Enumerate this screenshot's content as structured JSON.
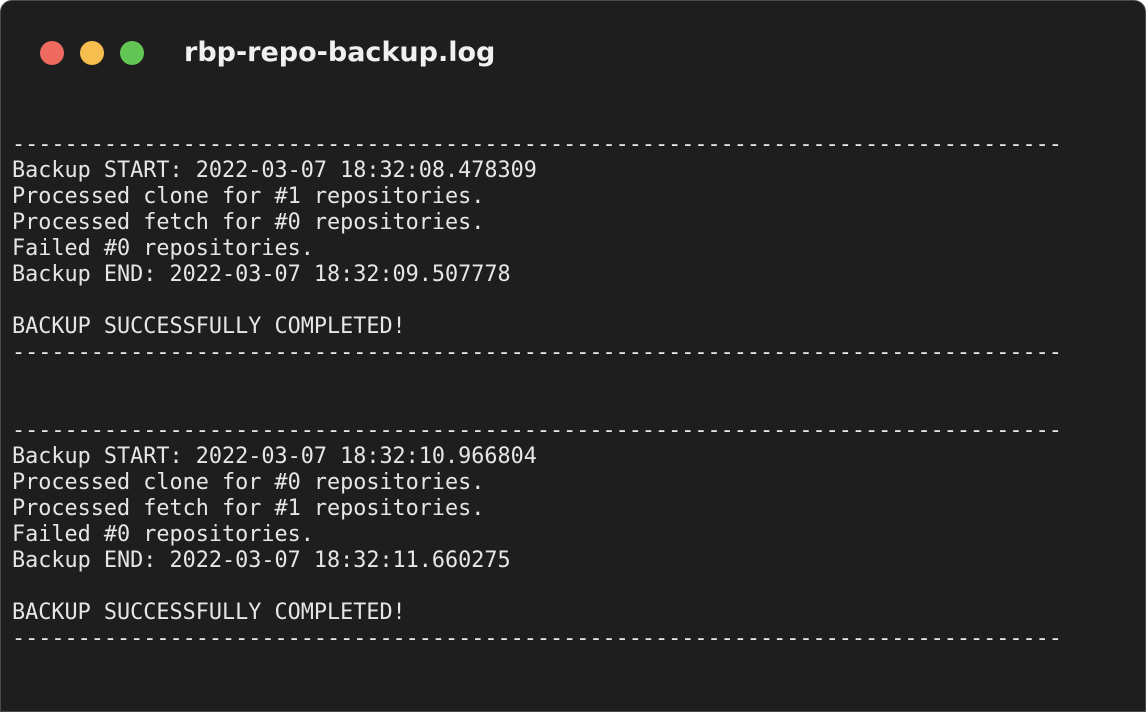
{
  "window": {
    "title": "rbp-repo-backup.log",
    "colors": {
      "background": "#1e1e1e",
      "text": "#e6e6e6",
      "close": "#ee6a5f",
      "minimize": "#f5be4f",
      "zoom": "#62c655"
    }
  },
  "log": {
    "lines": [
      "--------------------------------------------------------------------------------",
      "Backup START: 2022-03-07 18:32:08.478309",
      "Processed clone for #1 repositories.",
      "Processed fetch for #0 repositories.",
      "Failed #0 repositories.",
      "Backup END: 2022-03-07 18:32:09.507778",
      "",
      "BACKUP SUCCESSFULLY COMPLETED!",
      "--------------------------------------------------------------------------------",
      "",
      "",
      "--------------------------------------------------------------------------------",
      "Backup START: 2022-03-07 18:32:10.966804",
      "Processed clone for #0 repositories.",
      "Processed fetch for #1 repositories.",
      "Failed #0 repositories.",
      "Backup END: 2022-03-07 18:32:11.660275",
      "",
      "BACKUP SUCCESSFULLY COMPLETED!",
      "--------------------------------------------------------------------------------"
    ]
  }
}
